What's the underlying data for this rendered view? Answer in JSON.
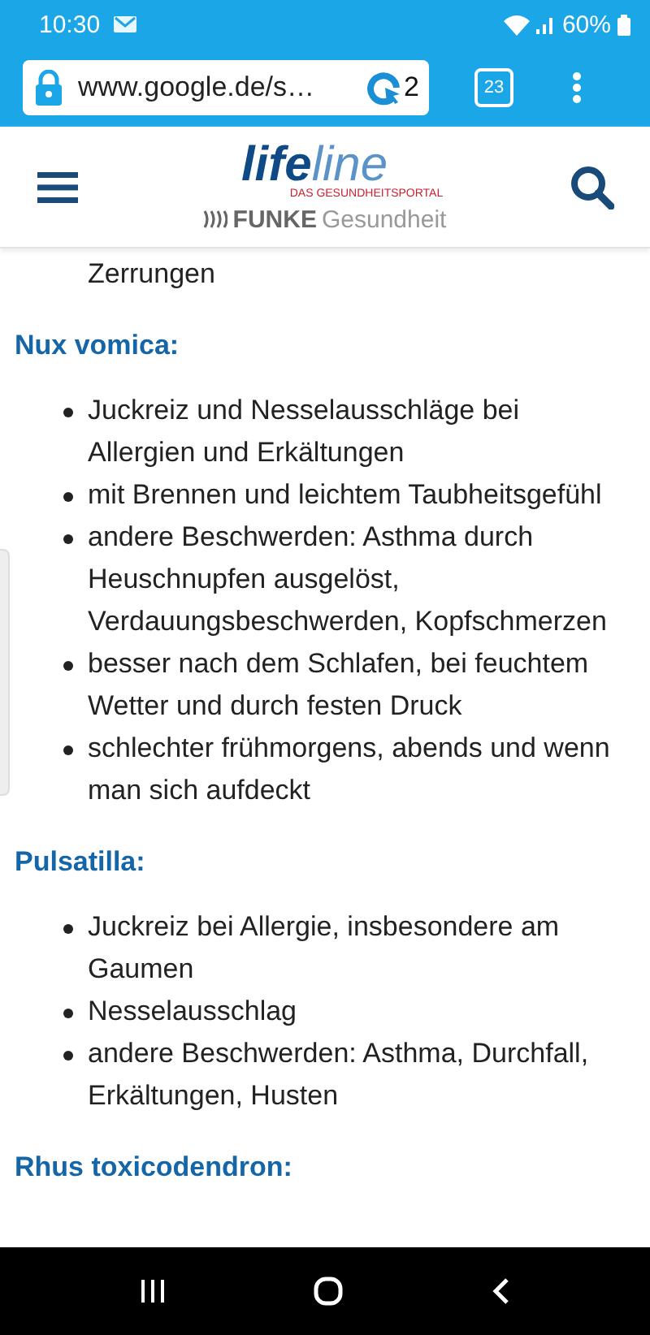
{
  "status_bar": {
    "time": "10:30",
    "battery": "60%"
  },
  "browser": {
    "url": "www.google.de/s…",
    "extension_count": "2",
    "tab_count": "23"
  },
  "header": {
    "logo_life": "life",
    "logo_line": "line",
    "tagline": "DAS GESUNDHEITSPORTAL",
    "brand": "FUNKE",
    "brand_suffix": "Gesundheit"
  },
  "article": {
    "lead_item": "Zerrungen",
    "sections": [
      {
        "heading": "Nux vomica:",
        "items": [
          "Juckreiz und Nesselausschläge bei Allergien und Erkältungen",
          "mit Brennen und leichtem Taubheitsgefühl",
          "andere Beschwerden: Asthma durch Heuschnupfen ausgelöst, Verdauungsbeschwerden, Kopfschmerzen",
          "besser nach dem Schlafen, bei feuchtem Wetter und durch festen Druck",
          "schlechter frühmorgens, abends und wenn man sich aufdeckt"
        ]
      },
      {
        "heading": "Pulsatilla:",
        "items": [
          "Juckreiz bei Allergie, insbesondere am Gaumen",
          "Nesselausschlag",
          "andere Beschwerden: Asthma, Durchfall, Erkältungen, Husten"
        ]
      },
      {
        "heading": "Rhus toxicodendron:"
      }
    ]
  }
}
